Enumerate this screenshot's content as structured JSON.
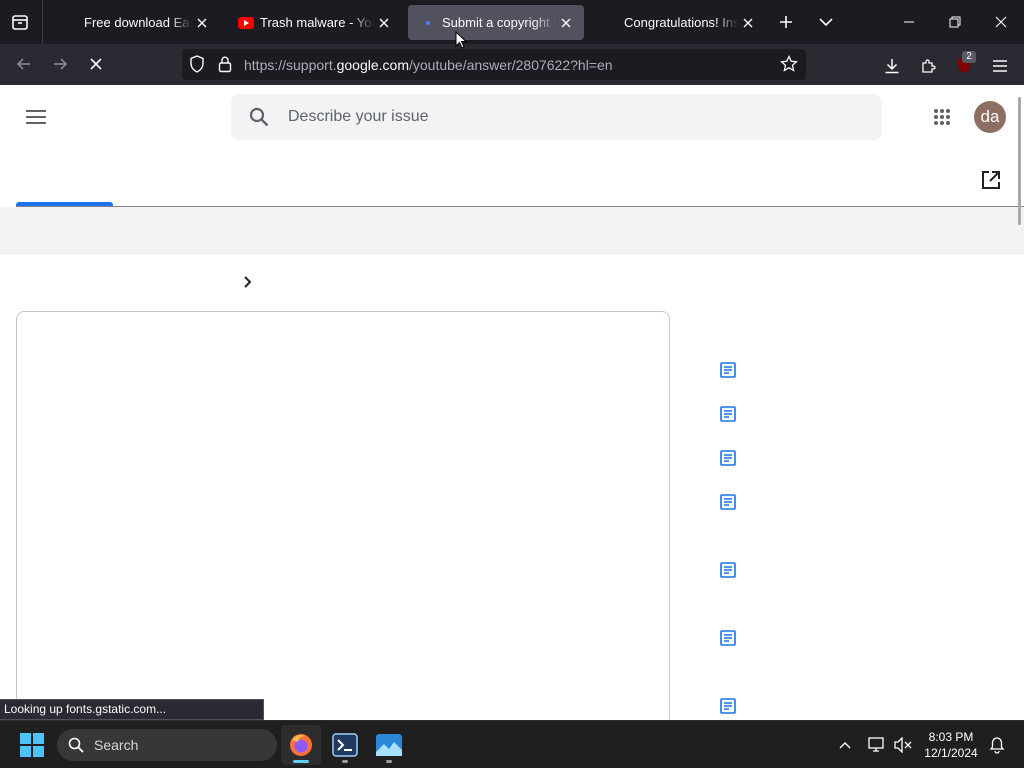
{
  "browser": {
    "tabs": [
      {
        "title": "Free download EaseUS",
        "active": false
      },
      {
        "title": "Trash malware - YouTube",
        "active": false
      },
      {
        "title": "Submit a copyright request",
        "active": true
      },
      {
        "title": "Congratulations! Installed",
        "active": false
      }
    ],
    "url": {
      "prefix": "https://support.",
      "host": "google.com",
      "path": "/youtube/answer/2807622?hl=en"
    },
    "extension_badge": "2"
  },
  "page": {
    "search_placeholder": "Describe your issue",
    "avatar_initials": "da",
    "sidebar_icons": [
      "article-icon",
      "article-icon",
      "article-icon",
      "article-icon",
      "article-icon",
      "article-icon",
      "article-icon"
    ]
  },
  "status_text": "Looking up fonts.gstatic.com...",
  "taskbar": {
    "search_label": "Search",
    "time": "8:03 PM",
    "date": "12/1/2024"
  },
  "colors": {
    "accent": "#1a73e8",
    "browser_dark": "#1c1b22",
    "toolbar": "#2b2a33",
    "avatar": "#8d6e63"
  }
}
